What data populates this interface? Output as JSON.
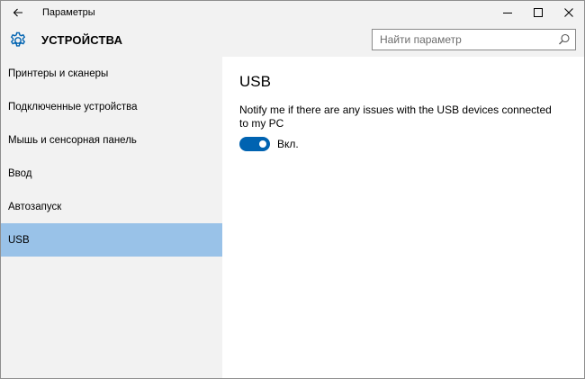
{
  "window": {
    "title": "Параметры"
  },
  "header": {
    "title": "УСТРОЙСТВА",
    "search_placeholder": "Найти параметр"
  },
  "sidebar": {
    "items": [
      {
        "label": "Принтеры и сканеры"
      },
      {
        "label": "Подключенные устройства"
      },
      {
        "label": "Мышь и сенсорная панель"
      },
      {
        "label": "Ввод"
      },
      {
        "label": "Автозапуск"
      },
      {
        "label": "USB",
        "active": true
      }
    ]
  },
  "main": {
    "title": "USB",
    "notify_text": "Notify me if there are any issues with the USB devices connected to my PC",
    "toggle": {
      "state": "on",
      "label": "Вкл."
    }
  },
  "colors": {
    "accent": "#0063b1",
    "sidebar_active": "#99c2e8",
    "chrome": "#f2f2f2"
  },
  "icons": {
    "back": "arrow-left-icon",
    "minimize": "minimize-icon",
    "maximize": "maximize-icon",
    "close": "close-icon",
    "header": "gear-icon",
    "search": "search-icon"
  }
}
